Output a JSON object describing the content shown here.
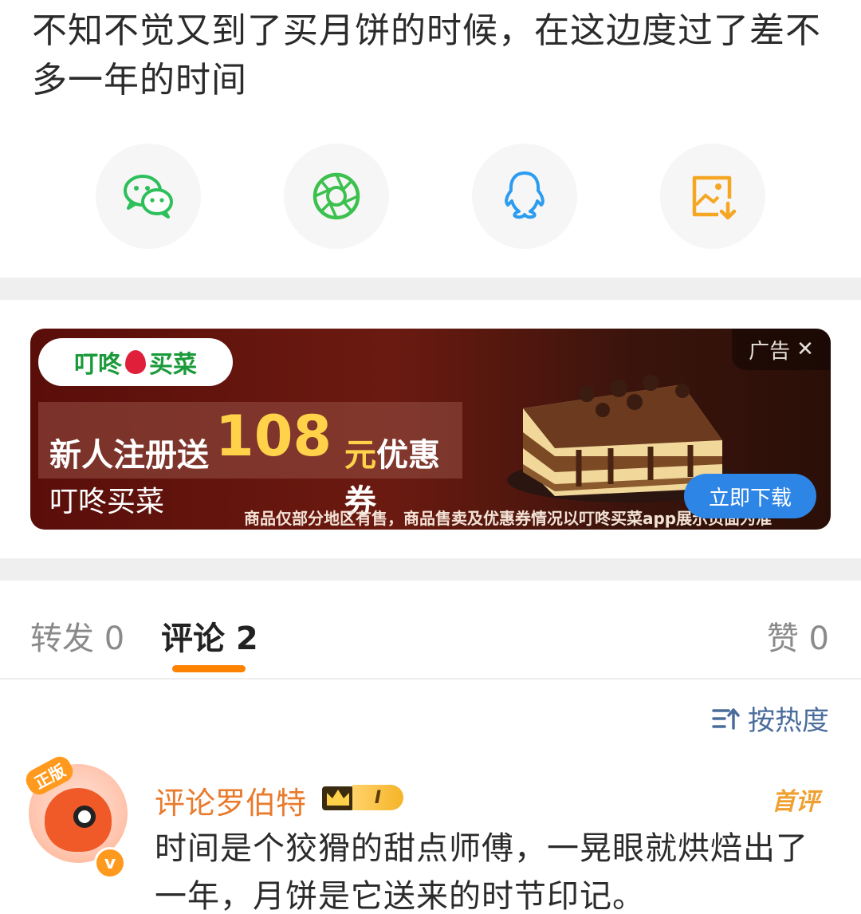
{
  "post": {
    "text": "不知不觉又到了买月饼的时候，在这边度过了差不多一年的时间"
  },
  "share": {
    "items": [
      {
        "icon": "wechat-icon",
        "color": "#2dbf5a"
      },
      {
        "icon": "moments-icon",
        "color": "#3cc04e"
      },
      {
        "icon": "qq-icon",
        "color": "#2b9cf0"
      },
      {
        "icon": "save-image-icon",
        "color": "#f5a623"
      }
    ]
  },
  "ad": {
    "logo_text_1": "叮咚",
    "logo_text_2": "买菜",
    "promo_part1": "新人注册送",
    "promo_amount": "108",
    "promo_part3": "元",
    "promo_part4": "优惠券",
    "brand": "叮咚买菜",
    "disclaimer": "商品仅部分地区有售，商品售卖及优惠券情况以叮咚买菜app展示页面为准",
    "label": "广告",
    "close_glyph": "✕",
    "cta": "立即下载"
  },
  "tabs": {
    "repost": "转发 0",
    "comments": "评论 2",
    "likes": "赞 0",
    "accent": "#ff8200"
  },
  "sort": {
    "label": "按热度"
  },
  "comment": {
    "avatar_badge": "正版",
    "verified_glyph": "v",
    "username": "评论罗伯特",
    "level": "I",
    "tag": "首评",
    "text": "时间是个狡猾的甜点师傅，一晃眼就烘焙出了一年，月饼是它送来的时节印记。"
  }
}
